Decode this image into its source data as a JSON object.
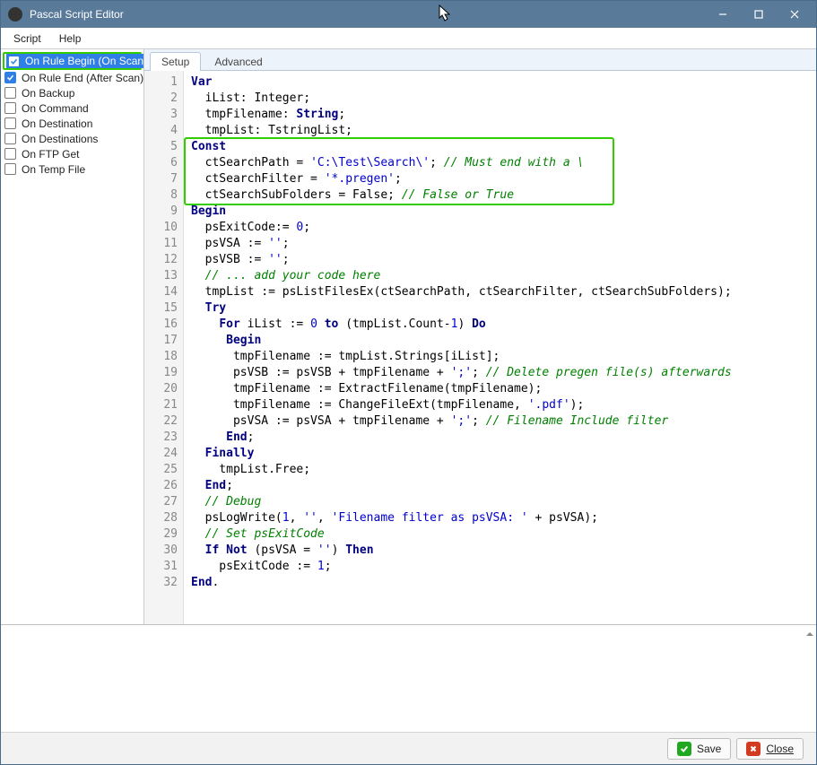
{
  "window": {
    "title": "Pascal Script Editor",
    "caption_buttons": {
      "min": "–",
      "max": "□",
      "close": "✕"
    }
  },
  "menu": {
    "items": [
      "Script",
      "Help"
    ]
  },
  "sidebar": {
    "items": [
      {
        "label": "On Rule Begin (On Scan)",
        "checked": true,
        "selected": true
      },
      {
        "label": "On Rule End (After Scan)",
        "checked": true
      },
      {
        "label": "On Backup",
        "checked": false
      },
      {
        "label": "On Command",
        "checked": false
      },
      {
        "label": "On Destination",
        "checked": false
      },
      {
        "label": "On Destinations",
        "checked": false
      },
      {
        "label": "On FTP Get",
        "checked": false
      },
      {
        "label": "On Temp File",
        "checked": false
      }
    ]
  },
  "tabs": {
    "items": [
      {
        "label": "Setup",
        "active": true
      },
      {
        "label": "Advanced",
        "active": false
      }
    ]
  },
  "code": {
    "lines": [
      {
        "n": 1,
        "t": [
          {
            "c": "kw",
            "s": "Var"
          }
        ]
      },
      {
        "n": 2,
        "t": [
          {
            "c": "plain",
            "s": "  iList: Integer;"
          }
        ]
      },
      {
        "n": 3,
        "t": [
          {
            "c": "plain",
            "s": "  tmpFilename: "
          },
          {
            "c": "kw",
            "s": "String"
          },
          {
            "c": "plain",
            "s": ";"
          }
        ]
      },
      {
        "n": 4,
        "t": [
          {
            "c": "plain",
            "s": "  tmpList: TstringList;"
          }
        ]
      },
      {
        "n": 5,
        "t": [
          {
            "c": "kw",
            "s": "Const"
          }
        ]
      },
      {
        "n": 6,
        "t": [
          {
            "c": "plain",
            "s": "  ctSearchPath = "
          },
          {
            "c": "str",
            "s": "'C:\\Test\\Search\\'"
          },
          {
            "c": "plain",
            "s": "; "
          },
          {
            "c": "cmt",
            "s": "// Must end with a \\"
          }
        ]
      },
      {
        "n": 7,
        "t": [
          {
            "c": "plain",
            "s": "  ctSearchFilter = "
          },
          {
            "c": "str",
            "s": "'*.pregen'"
          },
          {
            "c": "plain",
            "s": ";"
          }
        ]
      },
      {
        "n": 8,
        "t": [
          {
            "c": "plain",
            "s": "  ctSearchSubFolders = False; "
          },
          {
            "c": "cmt",
            "s": "// False or True"
          }
        ]
      },
      {
        "n": 9,
        "t": [
          {
            "c": "kw",
            "s": "Begin"
          }
        ]
      },
      {
        "n": 10,
        "t": [
          {
            "c": "plain",
            "s": "  psExitCode:= "
          },
          {
            "c": "num",
            "s": "0"
          },
          {
            "c": "plain",
            "s": ";"
          }
        ]
      },
      {
        "n": 11,
        "t": [
          {
            "c": "plain",
            "s": "  psVSA := "
          },
          {
            "c": "str",
            "s": "''"
          },
          {
            "c": "plain",
            "s": ";"
          }
        ]
      },
      {
        "n": 12,
        "t": [
          {
            "c": "plain",
            "s": "  psVSB := "
          },
          {
            "c": "str",
            "s": "''"
          },
          {
            "c": "plain",
            "s": ";"
          }
        ]
      },
      {
        "n": 13,
        "t": [
          {
            "c": "plain",
            "s": "  "
          },
          {
            "c": "cmt",
            "s": "// ... add your code here"
          }
        ]
      },
      {
        "n": 14,
        "t": [
          {
            "c": "plain",
            "s": "  tmpList := psListFilesEx(ctSearchPath, ctSearchFilter, ctSearchSubFolders);"
          }
        ]
      },
      {
        "n": 15,
        "t": [
          {
            "c": "plain",
            "s": "  "
          },
          {
            "c": "kw",
            "s": "Try"
          }
        ]
      },
      {
        "n": 16,
        "t": [
          {
            "c": "plain",
            "s": "    "
          },
          {
            "c": "kw",
            "s": "For"
          },
          {
            "c": "plain",
            "s": " iList := "
          },
          {
            "c": "num",
            "s": "0"
          },
          {
            "c": "plain",
            "s": " "
          },
          {
            "c": "kw",
            "s": "to"
          },
          {
            "c": "plain",
            "s": " (tmpList.Count-"
          },
          {
            "c": "num",
            "s": "1"
          },
          {
            "c": "plain",
            "s": ") "
          },
          {
            "c": "kw",
            "s": "Do"
          }
        ]
      },
      {
        "n": 17,
        "t": [
          {
            "c": "plain",
            "s": "     "
          },
          {
            "c": "kw",
            "s": "Begin"
          }
        ]
      },
      {
        "n": 18,
        "t": [
          {
            "c": "plain",
            "s": "      tmpFilename := tmpList.Strings[iList];"
          }
        ]
      },
      {
        "n": 19,
        "t": [
          {
            "c": "plain",
            "s": "      psVSB := psVSB + tmpFilename + "
          },
          {
            "c": "str",
            "s": "';'"
          },
          {
            "c": "plain",
            "s": "; "
          },
          {
            "c": "cmt",
            "s": "// Delete pregen file(s) afterwards"
          }
        ]
      },
      {
        "n": 20,
        "t": [
          {
            "c": "plain",
            "s": "      tmpFilename := ExtractFilename(tmpFilename);"
          }
        ]
      },
      {
        "n": 21,
        "t": [
          {
            "c": "plain",
            "s": "      tmpFilename := ChangeFileExt(tmpFilename, "
          },
          {
            "c": "str",
            "s": "'.pdf'"
          },
          {
            "c": "plain",
            "s": ");"
          }
        ]
      },
      {
        "n": 22,
        "t": [
          {
            "c": "plain",
            "s": "      psVSA := psVSA + tmpFilename + "
          },
          {
            "c": "str",
            "s": "';'"
          },
          {
            "c": "plain",
            "s": "; "
          },
          {
            "c": "cmt",
            "s": "// Filename Include filter"
          }
        ]
      },
      {
        "n": 23,
        "t": [
          {
            "c": "plain",
            "s": "     "
          },
          {
            "c": "kw",
            "s": "End"
          },
          {
            "c": "plain",
            "s": ";"
          }
        ]
      },
      {
        "n": 24,
        "t": [
          {
            "c": "plain",
            "s": "  "
          },
          {
            "c": "kw",
            "s": "Finally"
          }
        ]
      },
      {
        "n": 25,
        "t": [
          {
            "c": "plain",
            "s": "    tmpList.Free;"
          }
        ]
      },
      {
        "n": 26,
        "t": [
          {
            "c": "plain",
            "s": "  "
          },
          {
            "c": "kw",
            "s": "End"
          },
          {
            "c": "plain",
            "s": ";"
          }
        ]
      },
      {
        "n": 27,
        "t": [
          {
            "c": "plain",
            "s": "  "
          },
          {
            "c": "cmt",
            "s": "// Debug"
          }
        ]
      },
      {
        "n": 28,
        "t": [
          {
            "c": "plain",
            "s": "  psLogWrite("
          },
          {
            "c": "num",
            "s": "1"
          },
          {
            "c": "plain",
            "s": ", "
          },
          {
            "c": "str",
            "s": "''"
          },
          {
            "c": "plain",
            "s": ", "
          },
          {
            "c": "str",
            "s": "'Filename filter as psVSA: '"
          },
          {
            "c": "plain",
            "s": " + psVSA);"
          }
        ]
      },
      {
        "n": 29,
        "t": [
          {
            "c": "plain",
            "s": "  "
          },
          {
            "c": "cmt",
            "s": "// Set psExitCode"
          }
        ]
      },
      {
        "n": 30,
        "t": [
          {
            "c": "plain",
            "s": "  "
          },
          {
            "c": "kw",
            "s": "If Not"
          },
          {
            "c": "plain",
            "s": " (psVSA = "
          },
          {
            "c": "str",
            "s": "''"
          },
          {
            "c": "plain",
            "s": ") "
          },
          {
            "c": "kw",
            "s": "Then"
          }
        ]
      },
      {
        "n": 31,
        "t": [
          {
            "c": "plain",
            "s": "    psExitCode := "
          },
          {
            "c": "num",
            "s": "1"
          },
          {
            "c": "plain",
            "s": ";"
          }
        ]
      },
      {
        "n": 32,
        "t": [
          {
            "c": "kw",
            "s": "End"
          },
          {
            "c": "plain",
            "s": "."
          }
        ]
      }
    ],
    "highlight_lines": {
      "start": 5,
      "end": 8
    }
  },
  "footer": {
    "save": "Save",
    "close": "Close"
  }
}
